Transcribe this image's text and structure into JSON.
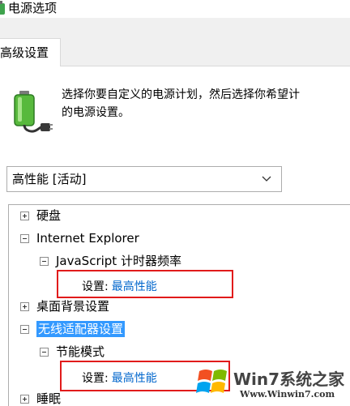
{
  "window": {
    "title": "电源选项"
  },
  "tabs": [
    {
      "label": "高级设置",
      "active": true
    }
  ],
  "description": "选择你要自定义的电源计划，然后选择你希望计\n的电源设置。",
  "plan_dropdown": {
    "value": "高性能 [活动]"
  },
  "tree": {
    "hard_disk": "硬盘",
    "ie": "Internet Explorer",
    "js_timer": "JavaScript 计时器频率",
    "setting_label_1": "设置:",
    "setting_value_1": "最高性能",
    "desktop_bg": "桌面背景设置",
    "wireless": "无线适配器设置",
    "power_save_mode": "节能模式",
    "setting_label_2": "设置:",
    "setting_value_2": "最高性能",
    "sleep": "睡眠"
  },
  "watermark": {
    "brand": "Win7系统之家",
    "url": "Www.Winwin7.com"
  },
  "colors": {
    "highlight": "#3399ff",
    "link": "#0066cc",
    "annotation": "#e11b1b"
  },
  "icons": {
    "app": "power-options-icon",
    "battery": "battery-plug-icon",
    "dropdown": "chevron-down-icon"
  }
}
